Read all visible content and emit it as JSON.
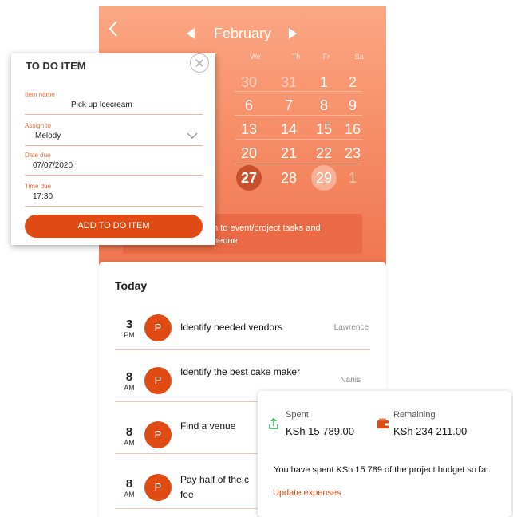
{
  "calendar": {
    "month": "February",
    "weekdays": [
      "We",
      "Th",
      "Fr",
      "Sa"
    ],
    "rows": [
      [
        {
          "d": "30",
          "f": true
        },
        {
          "d": "31",
          "f": true
        },
        {
          "d": "1"
        },
        {
          "d": "2"
        }
      ],
      [
        {
          "d": "6"
        },
        {
          "d": "7"
        },
        {
          "d": "8"
        },
        {
          "d": "9"
        }
      ],
      [
        {
          "d": "13"
        },
        {
          "d": "14"
        },
        {
          "d": "15"
        },
        {
          "d": "16"
        }
      ],
      [
        {
          "d": "20"
        },
        {
          "d": "21"
        },
        {
          "d": "22"
        },
        {
          "d": "23"
        }
      ],
      [
        {
          "d": "27",
          "today": true
        },
        {
          "d": "28"
        },
        {
          "d": "29",
          "sel": true
        },
        {
          "d": "1",
          "f": true
        }
      ]
    ],
    "banner_line1": "m to event/project tasks and",
    "banner_line2": "meone"
  },
  "today": {
    "title": "Today",
    "tasks": [
      {
        "num": "3",
        "ampm": "PM",
        "avatar": "P",
        "title": "Identify needed vendors",
        "owner": "Lawrence"
      },
      {
        "num": "8",
        "ampm": "AM",
        "avatar": "P",
        "title": "Identify the best cake maker",
        "owner": "Nanis"
      },
      {
        "num": "8",
        "ampm": "AM",
        "avatar": "P",
        "title": "Find a venue",
        "owner": ""
      },
      {
        "num": "8",
        "ampm": "AM",
        "avatar": "P",
        "title": "Pay half of the c fee",
        "owner": ""
      }
    ]
  },
  "todo": {
    "title": "TO DO ITEM",
    "fields": {
      "item_name": {
        "label": "Item name",
        "value": "Pick up Icecream"
      },
      "assign_to": {
        "label": "Assign to",
        "value": "Melody"
      },
      "date_due": {
        "label": "Date due",
        "value": "07/07/2020"
      },
      "time_due": {
        "label": "Time due",
        "value": "17:30"
      }
    },
    "button": "ADD TO DO ITEM"
  },
  "budget": {
    "spent_label": "Spent",
    "spent_value": "KSh 15 789.00",
    "remaining_label": "Remaining",
    "remaining_value": "KSh 234 211.00",
    "message": "You have spent KSh 15 789 of the project budget so far.",
    "link": "Update expenses"
  },
  "colors": {
    "accent": "#e04a13",
    "calendar_top": "#fba784",
    "calendar_bottom": "#ef7650"
  },
  "icons": [
    "back-arrow-icon",
    "triangle-left-icon",
    "triangle-right-icon",
    "close-icon",
    "chevron-down-icon",
    "upload-icon",
    "wallet-icon"
  ]
}
